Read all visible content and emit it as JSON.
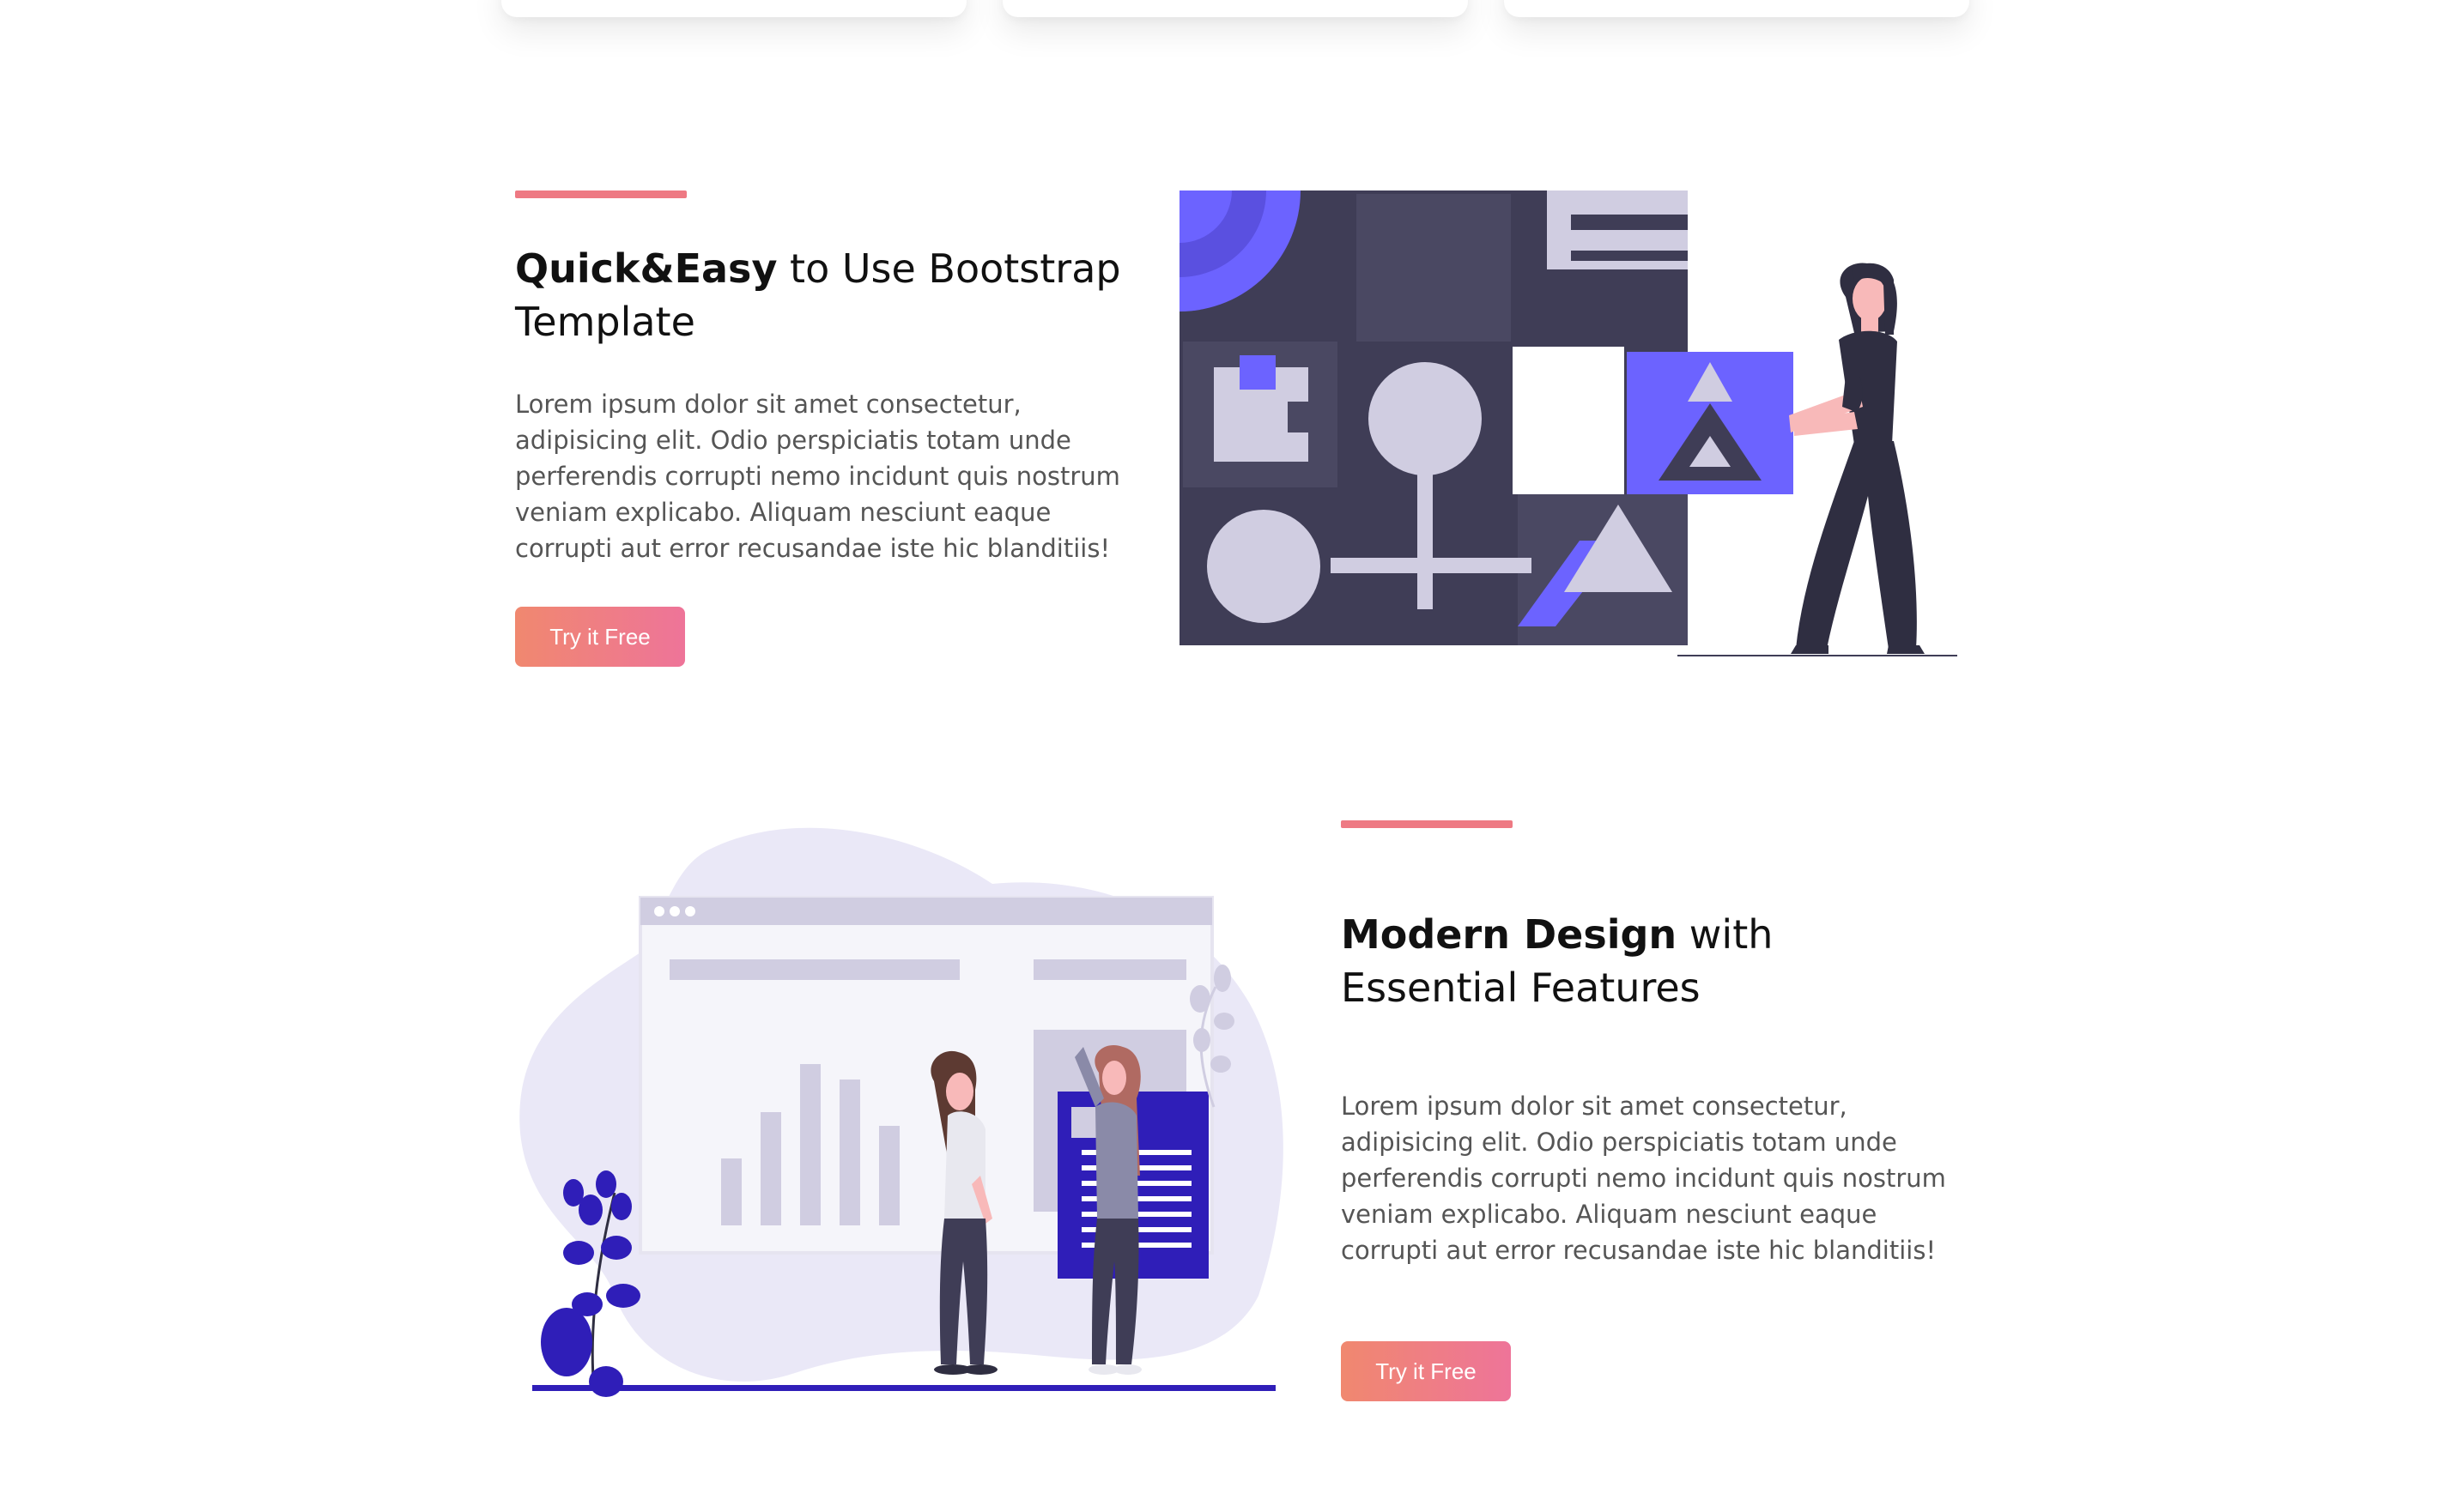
{
  "colors": {
    "accent": "#ee7983",
    "button_gradient_start": "#f0886f",
    "button_gradient_end": "#ee7499",
    "purple": "#6c63ff",
    "dark_purple": "#2f1eb8",
    "dark_tile": "#3f3d56",
    "light_lilac": "#d0cde1"
  },
  "features": [
    {
      "title_strong": "Quick&Easy",
      "title_rest": " to Use Bootstrap Template",
      "text": "Lorem ipsum dolor sit amet consectetur, adipisicing elit. Odio perspiciatis totam unde perferendis corrupti nemo incidunt quis nostrum veniam explicabo. Aliquam nesciunt eaque corrupti aut error recusandae iste hic blanditiis!",
      "button_label": "Try it Free",
      "illustration": "building-blocks-illustration"
    },
    {
      "title_strong": "Modern Design",
      "title_rest": " with Essential Features",
      "text": "Lorem ipsum dolor sit amet consectetur, adipisicing elit. Odio perspiciatis totam unde perferendis corrupti nemo incidunt quis nostrum veniam explicabo. Aliquam nesciunt eaque corrupti aut error recusandae iste hic blanditiis!",
      "button_label": "Try it Free",
      "illustration": "dashboard-team-illustration"
    }
  ]
}
